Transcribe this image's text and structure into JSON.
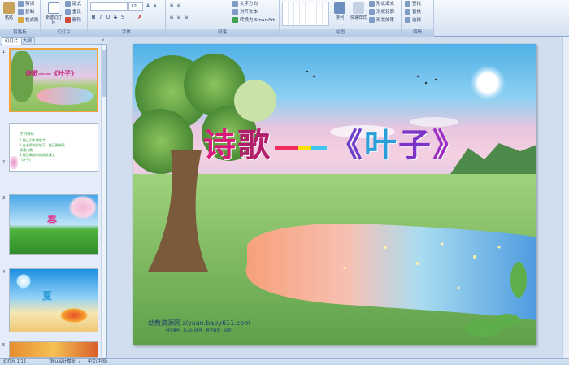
{
  "ribbon": {
    "clipboard": {
      "paste": "粘贴",
      "cut": "剪切",
      "copy": "复制",
      "format_painter": "格式刷",
      "label": "剪贴板"
    },
    "slides": {
      "new_slide": "新建幻灯片",
      "layout": "版式",
      "reset": "重设",
      "delete": "删除",
      "label": "幻灯片"
    },
    "font": {
      "size": "32",
      "label": "字体"
    },
    "paragraph": {
      "text_direction": "文字方向",
      "align_text": "对齐文本",
      "smartart": "转换为 SmartArt",
      "label": "段落"
    },
    "drawing": {
      "arrange": "排列",
      "quick_styles": "快速样式",
      "shape_fill": "形状填充",
      "shape_outline": "形状轮廓",
      "shape_effects": "形状效果",
      "label": "绘图"
    },
    "editing": {
      "find": "查找",
      "replace": "替换",
      "select": "选择",
      "label": "编辑"
    }
  },
  "pane": {
    "tabs": {
      "slides": "幻灯片",
      "outline": "大纲",
      "close": "×"
    },
    "thumbs": [
      {
        "num": "1",
        "text": "诗歌——《叶子》"
      },
      {
        "num": "2",
        "text": "学习目标",
        "lines": [
          "1.能认识本课生字",
          "2.在老师的帮助下，能正确朗读",
          "读通诗歌",
          "3.能正确流利地朗读课文",
          "《叶子》"
        ]
      },
      {
        "num": "3",
        "text": "春"
      },
      {
        "num": "4",
        "text": "夏"
      },
      {
        "num": "5",
        "text": ""
      }
    ]
  },
  "slide": {
    "title_shi": "诗",
    "title_ge": "歌",
    "title_lb": "《",
    "title_ye": "叶",
    "title_zi": "子",
    "title_rb": "》",
    "watermark": "幼教资源网 ziyuan.baby611.com",
    "watermark_sub": "PPT课件 · FLASH课件 · 教学教案 · 试卷"
  },
  "status": {
    "slide_info": "幻灯片 1/13",
    "theme": "\"默认设计模板\"",
    "language": "中文(中国)"
  },
  "colors": {
    "ribbon_bg": "#e4ecf7",
    "selection": "#f2a33a"
  }
}
